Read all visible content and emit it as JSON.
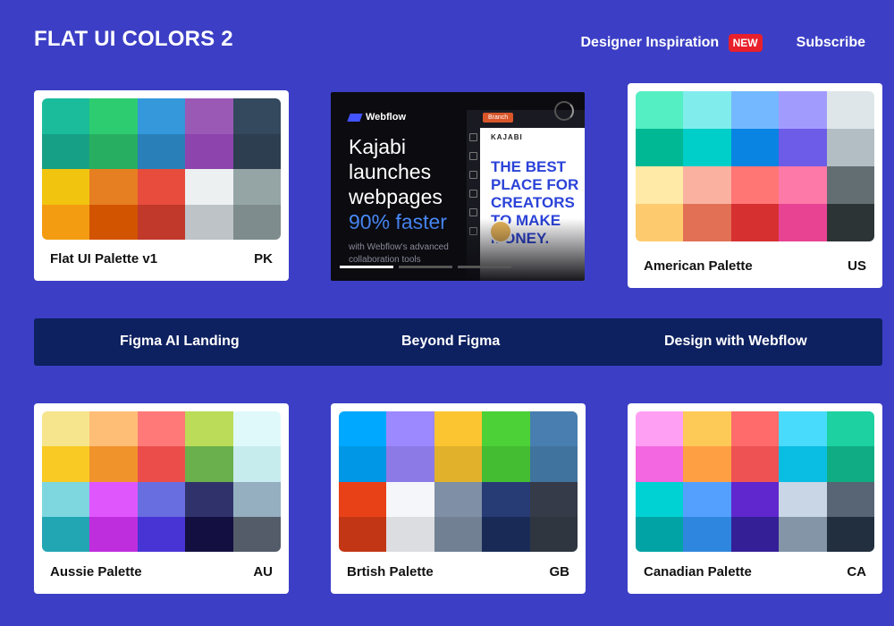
{
  "header": {
    "brand": "FLAT UI COLORS 2",
    "nav": {
      "inspiration": "Designer Inspiration",
      "badge": "NEW",
      "subscribe": "Subscribe"
    }
  },
  "ad": {
    "logo": "Webflow",
    "headline": "Kajabi launches webpages",
    "headline_accent": "90% faster",
    "subtext": "with Webflow's advanced collaboration tools",
    "branch": "Branch",
    "kajabi": "KAJABI",
    "kajabi_headline": "THE BEST PLACE FOR CREATORS TO MAKE MONEY."
  },
  "banner": {
    "links": [
      "Figma AI Landing",
      "Beyond Figma",
      "Design with Webflow"
    ]
  },
  "palettes": [
    {
      "name": "Flat UI Palette v1",
      "code": "PK",
      "colors": [
        "#1abc9c",
        "#2ecc71",
        "#3498db",
        "#9b59b6",
        "#34495e",
        "#16a085",
        "#27ae60",
        "#2980b9",
        "#8e44ad",
        "#2c3e50",
        "#f1c40f",
        "#e67e22",
        "#e74c3c",
        "#ecf0f1",
        "#95a5a6",
        "#f39c12",
        "#d35400",
        "#c0392b",
        "#bdc3c7",
        "#7f8c8d"
      ]
    },
    {
      "name": "American Palette",
      "code": "US",
      "colors": [
        "#55efc4",
        "#81ecec",
        "#74b9ff",
        "#a29bfe",
        "#dfe6e9",
        "#00b894",
        "#00cec9",
        "#0984e3",
        "#6c5ce7",
        "#b2bec3",
        "#ffeaa7",
        "#fab1a0",
        "#ff7675",
        "#fd79a8",
        "#636e72",
        "#fdcb6e",
        "#e17055",
        "#d63031",
        "#e84393",
        "#2d3436"
      ]
    },
    {
      "name": "Aussie Palette",
      "code": "AU",
      "colors": [
        "#f6e58d",
        "#ffbe76",
        "#ff7979",
        "#badc58",
        "#dff9fb",
        "#f9ca24",
        "#f0932b",
        "#eb4d4b",
        "#6ab04c",
        "#c7ecee",
        "#7ed6df",
        "#e056fd",
        "#686de0",
        "#30336b",
        "#95afc0",
        "#22a6b3",
        "#be2edd",
        "#4834d4",
        "#130f40",
        "#535c68"
      ]
    },
    {
      "name": "Brtish Palette",
      "code": "GB",
      "colors": [
        "#00a8ff",
        "#9c88ff",
        "#fbc531",
        "#4cd137",
        "#487eb0",
        "#0097e6",
        "#8c7ae6",
        "#e1b12c",
        "#44bd32",
        "#40739e",
        "#e84118",
        "#f5f6fa",
        "#7f8fa6",
        "#273c75",
        "#353b48",
        "#c23616",
        "#dcdde1",
        "#718093",
        "#192a56",
        "#2f3640"
      ]
    },
    {
      "name": "Canadian Palette",
      "code": "CA",
      "colors": [
        "#ff9ff3",
        "#feca57",
        "#ff6b6b",
        "#48dbfb",
        "#1dd1a1",
        "#f368e0",
        "#ff9f43",
        "#ee5253",
        "#0abde3",
        "#10ac84",
        "#00d2d3",
        "#54a0ff",
        "#5f27cd",
        "#c8d6e5",
        "#576574",
        "#01a3a4",
        "#2e86de",
        "#341f97",
        "#8395a7",
        "#222f3e"
      ]
    }
  ]
}
